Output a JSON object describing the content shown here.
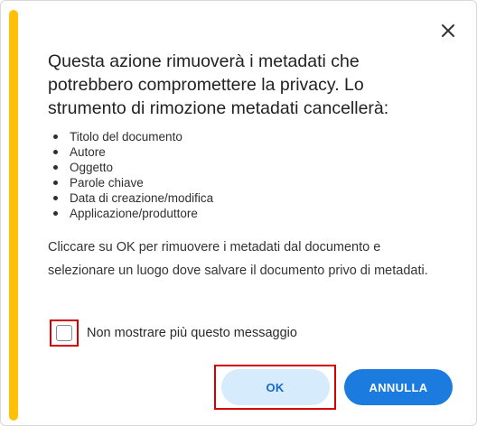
{
  "dialog": {
    "title": "Questa azione rimuoverà i metadati che potrebbero compromettere la privacy. Lo strumento di rimozione metadati cancellerà:",
    "items": [
      "Titolo del documento",
      "Autore",
      "Oggetto",
      "Parole chiave",
      "Data di creazione/modifica",
      "Applicazione/produttore"
    ],
    "description": "Cliccare su OK per rimuovere i metadati dal documento e selezionare un luogo dove salvare il documento privo di metadati.",
    "checkbox_label": "Non mostrare più questo messaggio",
    "checkbox_checked": false,
    "ok_label": "OK",
    "cancel_label": "ANNULLA",
    "close_icon": "close-icon"
  },
  "colors": {
    "accent_bar": "#ffc107",
    "ok_bg": "#d6ebfb",
    "ok_text": "#1769c9",
    "cancel_bg": "#1b7bdf",
    "highlight": "#d50000"
  }
}
